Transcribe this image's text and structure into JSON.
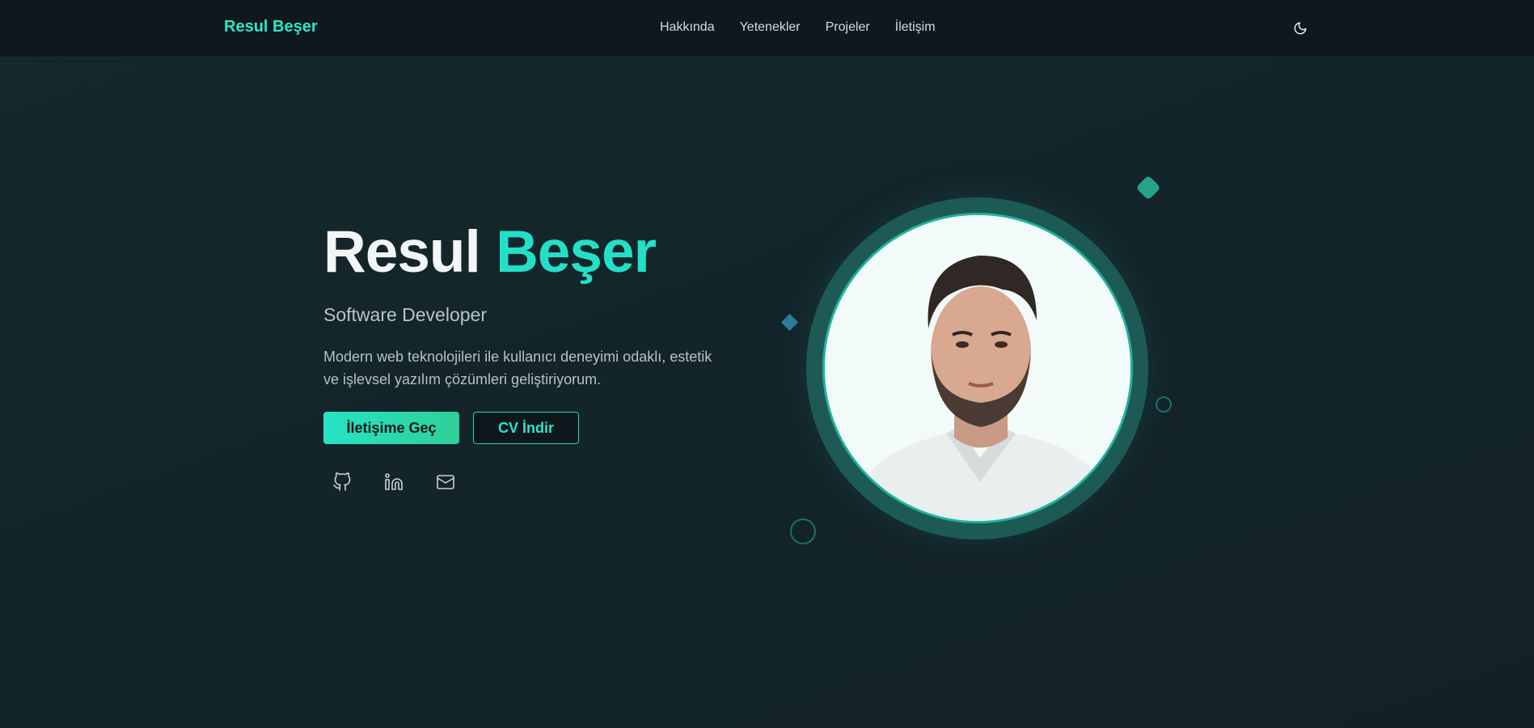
{
  "nav": {
    "brand": "Resul Beşer",
    "links": [
      "Hakkında",
      "Yetenekler",
      "Projeler",
      "İletişim"
    ],
    "theme_icon": "moon-icon"
  },
  "hero": {
    "first_name": "Resul",
    "last_name": "Beşer",
    "role": "Software Developer",
    "description": "Modern web teknolojileri ile kullanıcı deneyimi odaklı, estetik ve işlevsel yazılım çözümleri geliştiriyorum.",
    "primary_button": "İletişime Geç",
    "secondary_button": "CV İndir",
    "socials": [
      "github-icon",
      "linkedin-icon",
      "mail-icon"
    ]
  },
  "colors": {
    "accent": "#22e0c8",
    "background": "#13252a",
    "navbar": "#0f181d"
  }
}
